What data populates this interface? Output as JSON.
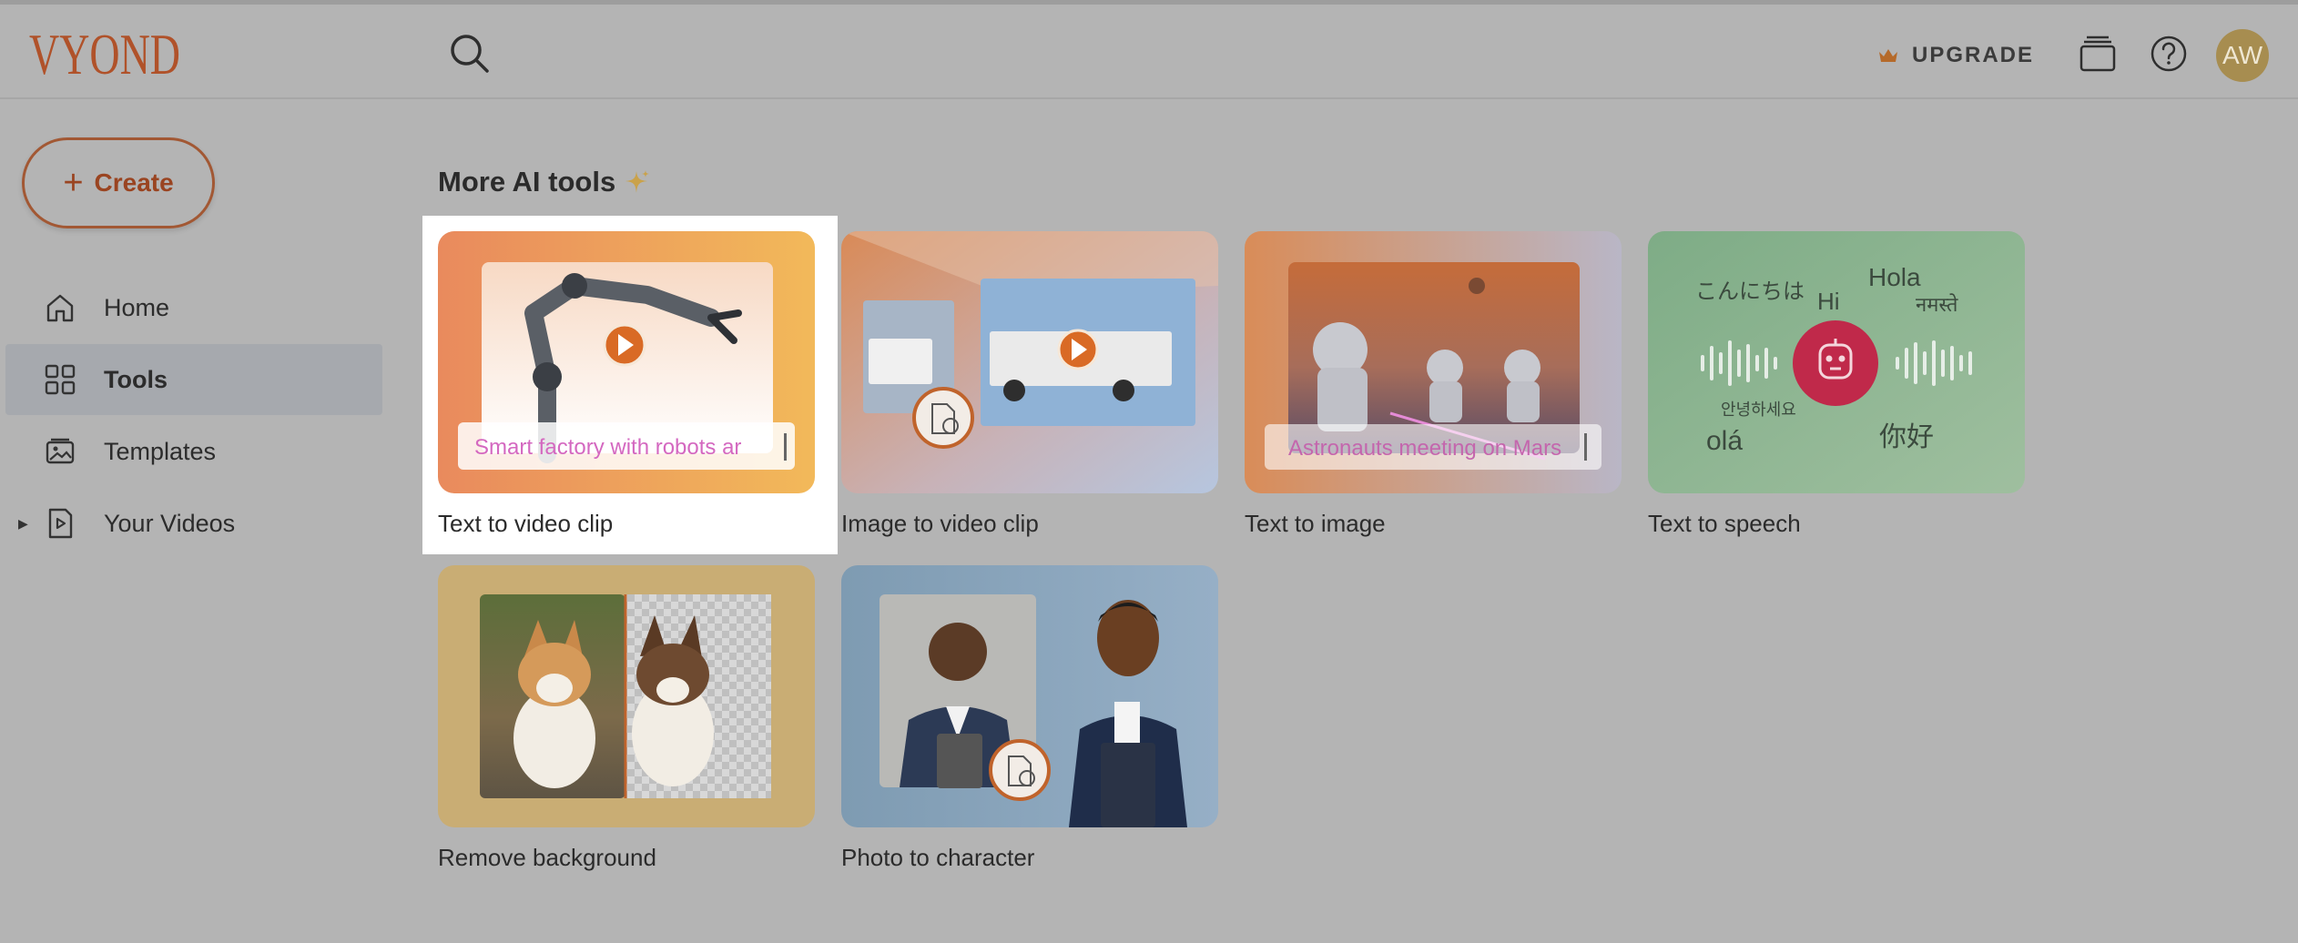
{
  "header": {
    "logo_text": "VYOND",
    "upgrade_label": "UPGRADE",
    "avatar_initials": "AW"
  },
  "sidebar": {
    "create_label": "Create",
    "items": [
      {
        "label": "Home",
        "icon": "home-icon"
      },
      {
        "label": "Tools",
        "icon": "grid-icon",
        "active": true
      },
      {
        "label": "Templates",
        "icon": "templates-icon"
      },
      {
        "label": "Your Videos",
        "icon": "video-file-icon"
      }
    ]
  },
  "main": {
    "section_title": "More AI tools",
    "tools": [
      {
        "label": "Text to video clip",
        "prompt_text": "Smart factory with robots ar"
      },
      {
        "label": "Image to video clip"
      },
      {
        "label": "Text to image",
        "prompt_text": "Astronauts meeting on Mars"
      },
      {
        "label": "Text to speech",
        "greetings": [
          "こんにちは",
          "Hola",
          "Hi",
          "नमस्ते",
          "안녕하세요",
          "olá",
          "你好"
        ]
      },
      {
        "label": "Remove background"
      },
      {
        "label": "Photo to character"
      }
    ]
  },
  "colors": {
    "brand": "#b0522a",
    "background": "#b4b4b4",
    "active_nav": "#a6a9ae",
    "speech_badge": "#c0294a"
  }
}
